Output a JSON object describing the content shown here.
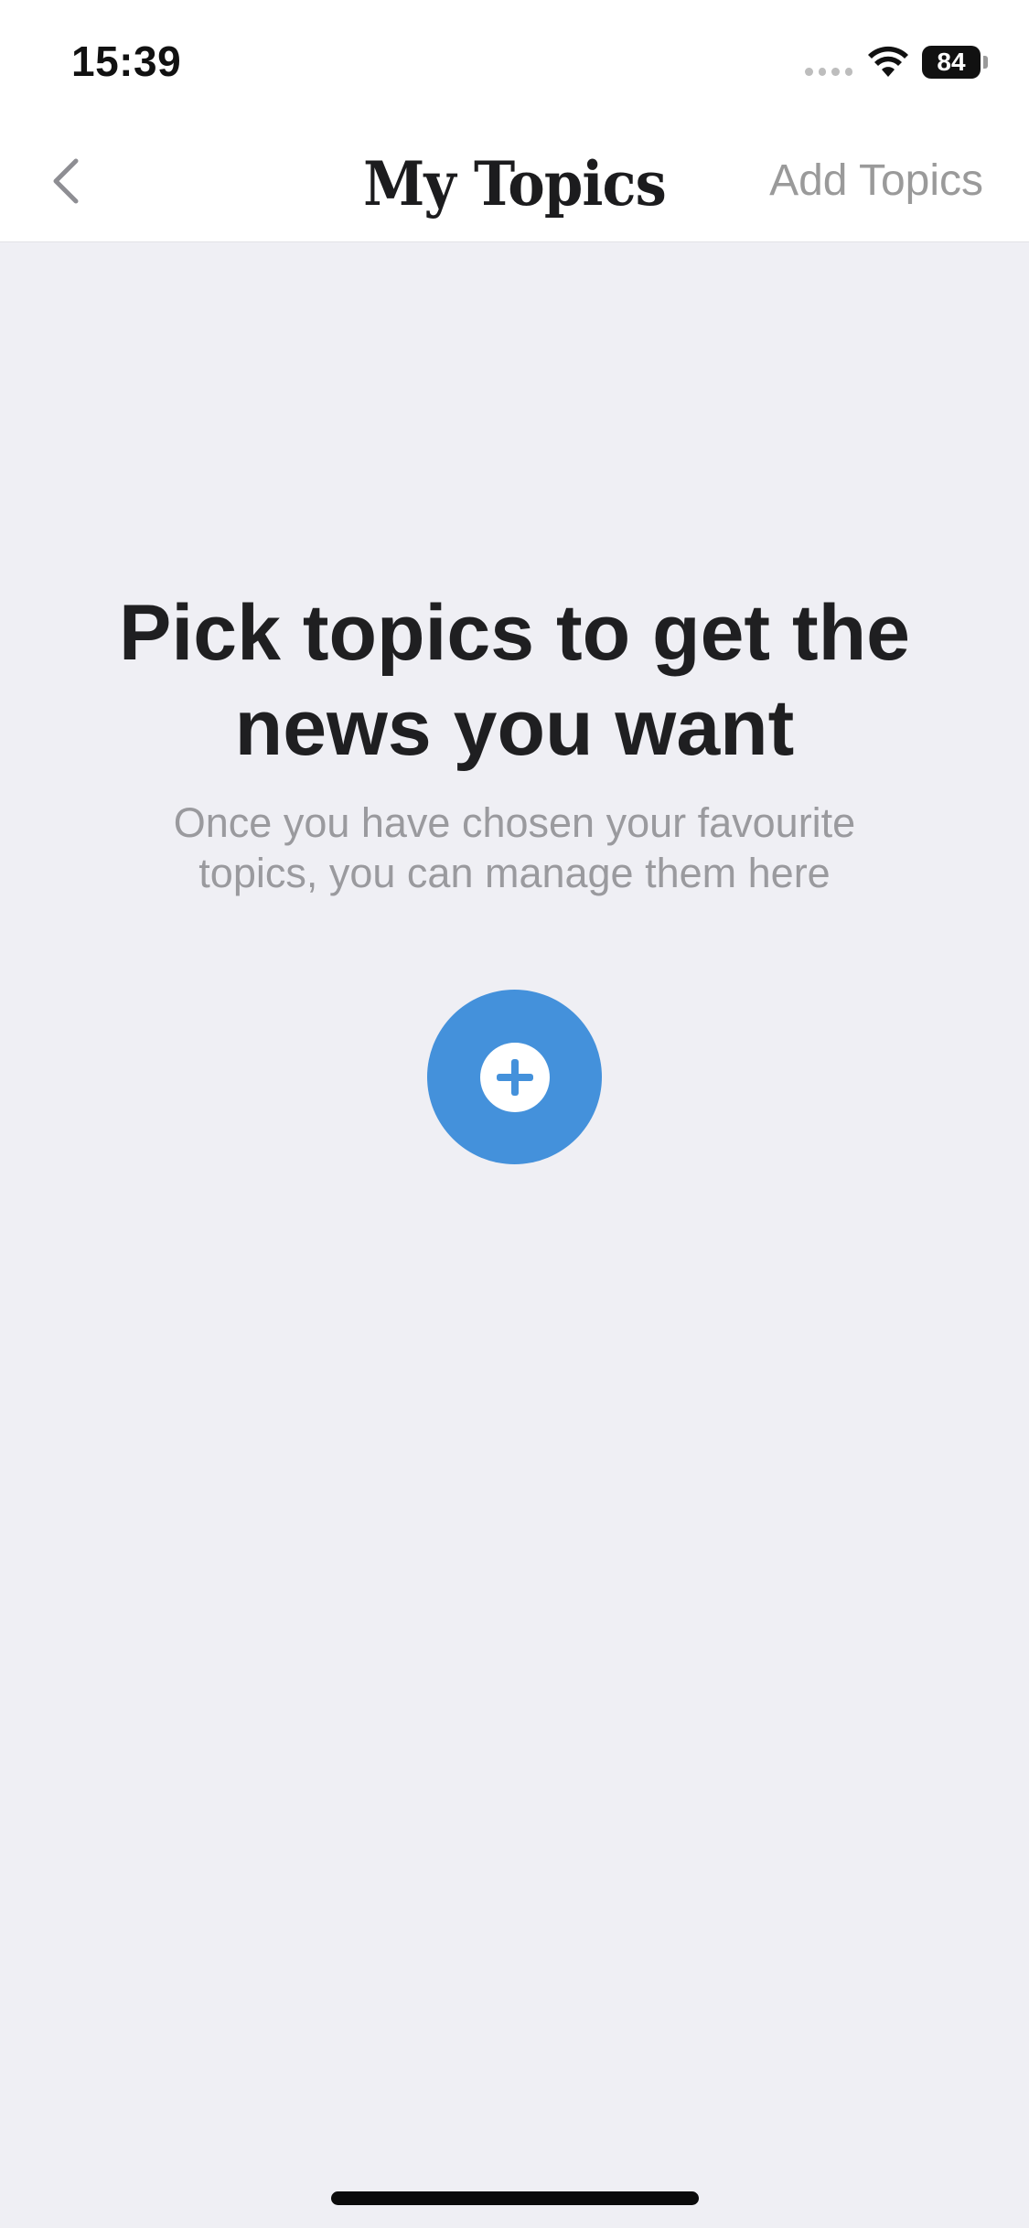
{
  "status_bar": {
    "time": "15:39",
    "battery_level": "84"
  },
  "nav": {
    "title": "My Topics",
    "action_label": "Add Topics"
  },
  "empty_state": {
    "title": "Pick topics to get the news you want",
    "subtitle": "Once you have chosen your favourite topics, you can manage them here"
  },
  "colors": {
    "accent": "#4491db",
    "background": "#efeff4",
    "nav_background": "#ffffff",
    "muted_text": "#9a9a9e",
    "title_text": "#1f1f21"
  },
  "icons": {
    "back": "chevron-left-icon",
    "add": "plus-circle-icon",
    "wifi": "wifi-icon",
    "battery": "battery-icon",
    "signal": "signal-icon"
  }
}
